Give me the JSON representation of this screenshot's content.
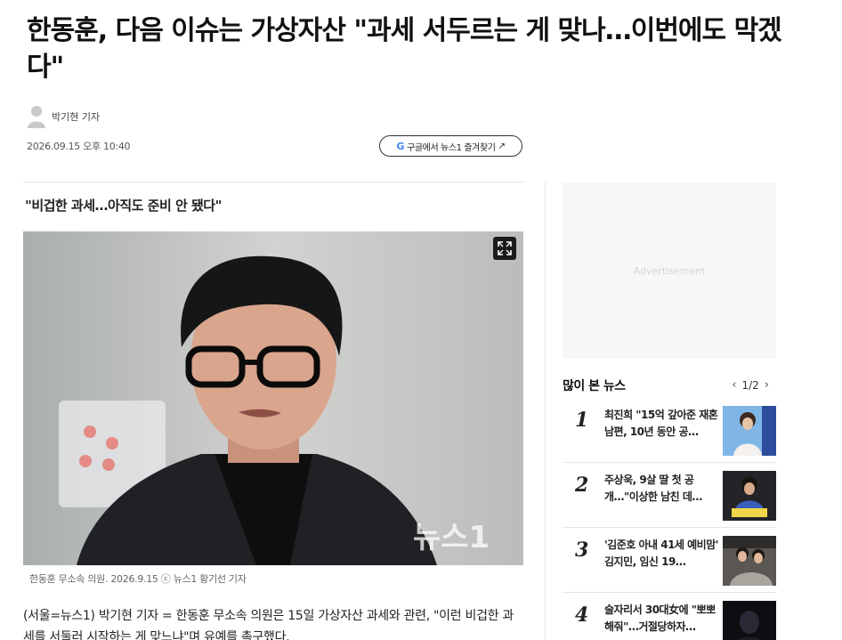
{
  "article": {
    "headline": "한동훈, 다음 이슈는 가상자산 \"과세 서두르는 게 맞나…이번에도 막겠다\"",
    "reporter": "박기현 기자",
    "datetime": "2026.09.15 오후 10:40",
    "google_button_label": "구글에서 뉴스1 즐겨찾기",
    "subheadline": "\"비겁한 과세…아직도 준비 안 됐다\"",
    "photo_watermark": "뉴스1",
    "photo_caption": "한동훈 무소속 의원. 2026.9.15 ⓒ 뉴스1 황기선 기자",
    "body": "(서울=뉴스1) 박기현 기자 = 한동훈 무소속 의원은 15일 가상자산 과세와 관련, \"이런 비겁한 과세를 서둘러 시작하는 게 맞느냐\"며 유예를 촉구했다."
  },
  "sidebar": {
    "ad_label": "Advertisement",
    "popular": {
      "title": "많이 본 뉴스",
      "page_indicator": "1/2",
      "items": [
        {
          "rank": "1",
          "title": "최진희 \"15억 갚아준 재혼 남편, 10년 동안 공…"
        },
        {
          "rank": "2",
          "title": "주상욱, 9살 딸 첫 공개…\"이상한 남친 데…"
        },
        {
          "rank": "3",
          "title": "'김준호 아내 41세 예비맘' 김지민, 임신 19…"
        },
        {
          "rank": "4",
          "title": "술자리서 30대女에 \"뽀뽀해줘\"…거절당하자…"
        }
      ]
    }
  },
  "colors": {
    "google_blue": "#4285F4",
    "divider": "#e2e2e2",
    "ad_bg": "#f7f7f7"
  },
  "icons": [
    "person-avatar-icon",
    "google-g-icon",
    "external-link-icon",
    "expand-icon",
    "chevron-left-icon",
    "chevron-right-icon"
  ]
}
